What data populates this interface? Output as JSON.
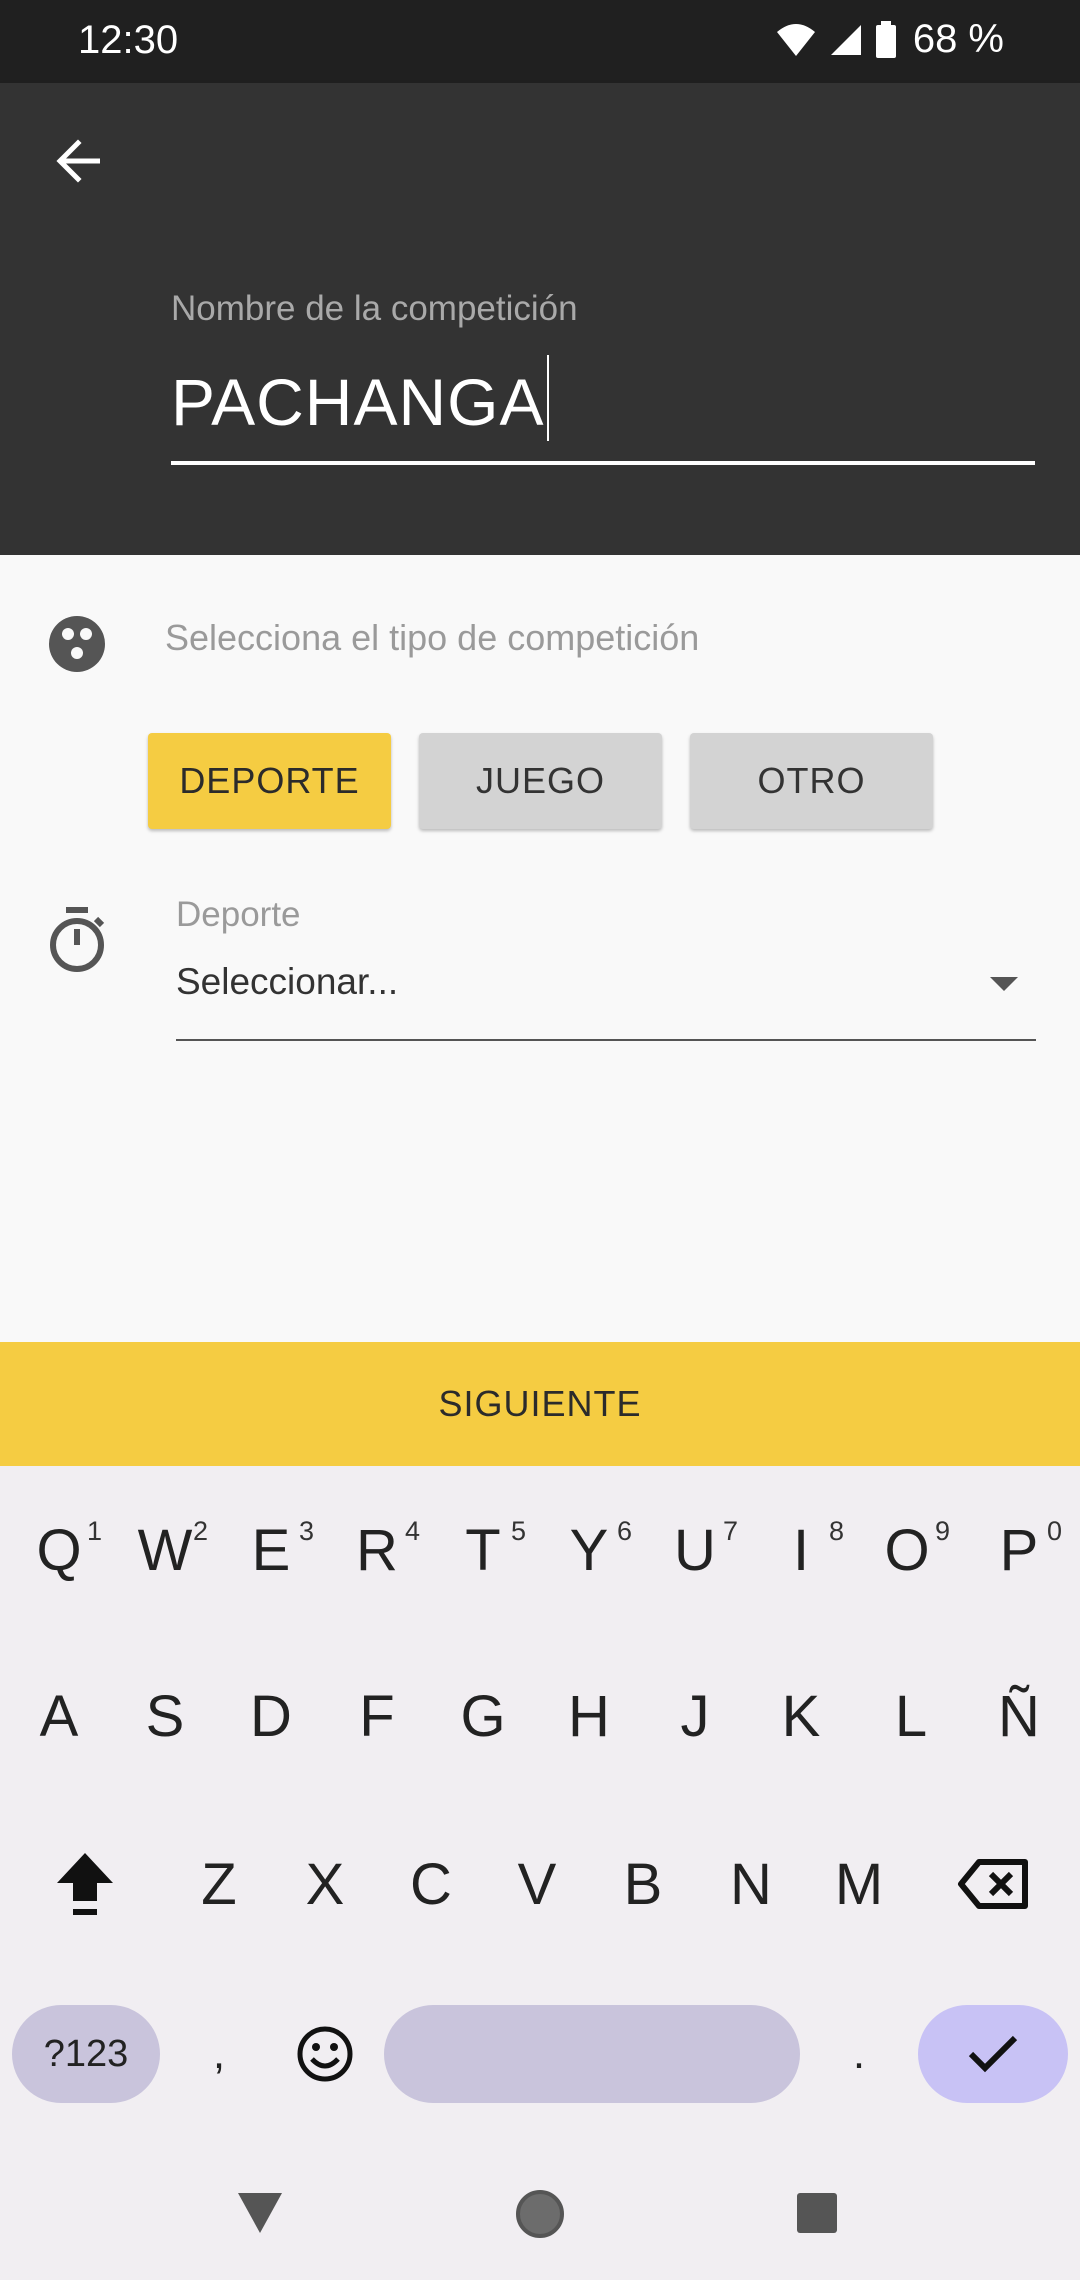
{
  "status_bar": {
    "time": "12:30",
    "battery_percent": "68 %",
    "icons": [
      "wifi-icon",
      "signal-icon",
      "battery-icon"
    ]
  },
  "app_bar": {
    "back_icon": "arrow-back-icon",
    "name_label": "Nombre de la competición",
    "name_value": "PACHANGA"
  },
  "form": {
    "type_icon": "dice-icon",
    "type_label": "Selecciona el tipo de competición",
    "types": [
      {
        "label": "DEPORTE",
        "selected": true
      },
      {
        "label": "JUEGO",
        "selected": false
      },
      {
        "label": "OTRO",
        "selected": false
      }
    ],
    "sport_icon": "timer-icon",
    "sport_label": "Deporte",
    "sport_value": "Seleccionar..."
  },
  "next_button": "SIGUIENTE",
  "keyboard": {
    "row1": [
      {
        "key": "Q",
        "hint": "1"
      },
      {
        "key": "W",
        "hint": "2"
      },
      {
        "key": "E",
        "hint": "3"
      },
      {
        "key": "R",
        "hint": "4"
      },
      {
        "key": "T",
        "hint": "5"
      },
      {
        "key": "Y",
        "hint": "6"
      },
      {
        "key": "U",
        "hint": "7"
      },
      {
        "key": "I",
        "hint": "8"
      },
      {
        "key": "O",
        "hint": "9"
      },
      {
        "key": "P",
        "hint": "0"
      }
    ],
    "row2": [
      "A",
      "S",
      "D",
      "F",
      "G",
      "H",
      "J",
      "K",
      "L",
      "Ñ"
    ],
    "row3": [
      "Z",
      "X",
      "C",
      "V",
      "B",
      "N",
      "M"
    ],
    "symbols_key": "?123",
    "comma_key": ",",
    "period_key": ".",
    "accent_color": "#c8c2f5",
    "pill_color": "#c9c4dc"
  },
  "colors": {
    "app_bar": "#333333",
    "accent": "#f5cc42",
    "chip_inactive": "#d3d3d3"
  }
}
